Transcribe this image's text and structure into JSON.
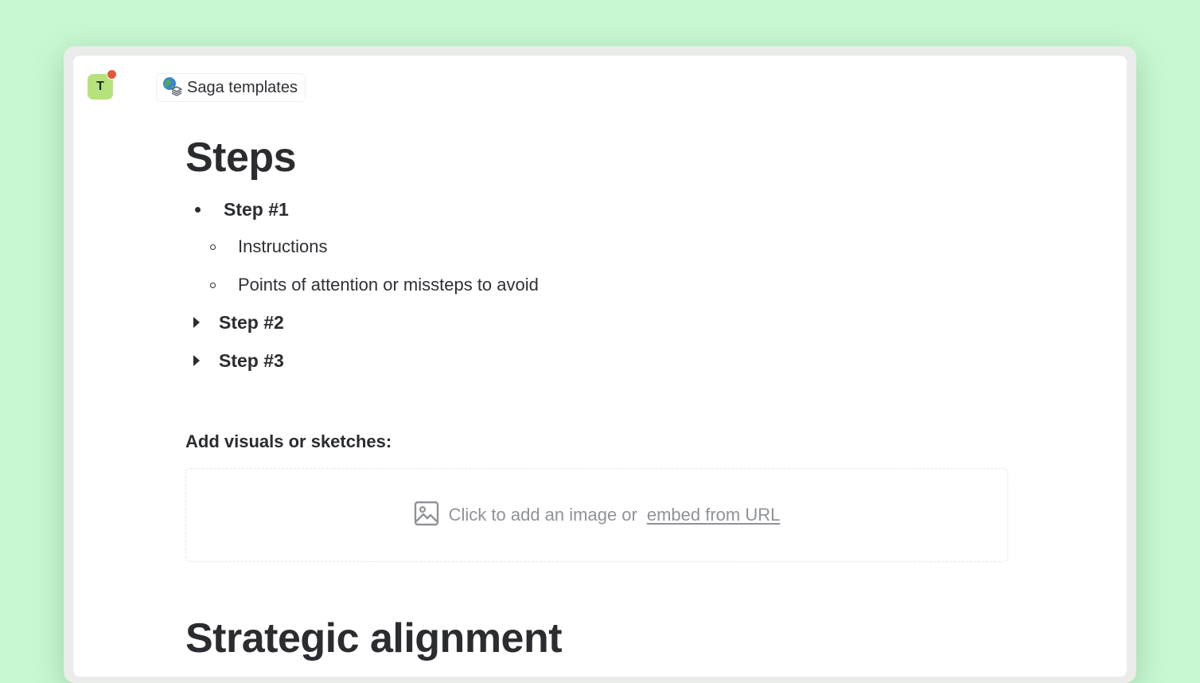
{
  "colors": {
    "background": "#c8f8d2",
    "window": "#ffffff",
    "avatar_bg": "#b6e27b",
    "notification_dot": "#e05a3a",
    "text": "#2a2c30",
    "muted_text": "#8f9297"
  },
  "avatar": {
    "initial": "T",
    "has_notification": true
  },
  "breadcrumb": {
    "icon": "globe-books-icon",
    "label": "Saga templates"
  },
  "steps_section": {
    "heading": "Steps",
    "items": [
      {
        "label": "Step #1",
        "expanded": true,
        "children": [
          {
            "label": "Instructions"
          },
          {
            "label": "Points of attention or missteps to avoid"
          }
        ]
      },
      {
        "label": "Step #2",
        "expanded": false
      },
      {
        "label": "Step #3",
        "expanded": false
      }
    ]
  },
  "visuals_section": {
    "label": "Add visuals or sketches:",
    "image_icon": "image-icon",
    "prompt": "Click to add an image or",
    "link_label": "embed from URL"
  },
  "strategic_section": {
    "heading": "Strategic alignment"
  }
}
